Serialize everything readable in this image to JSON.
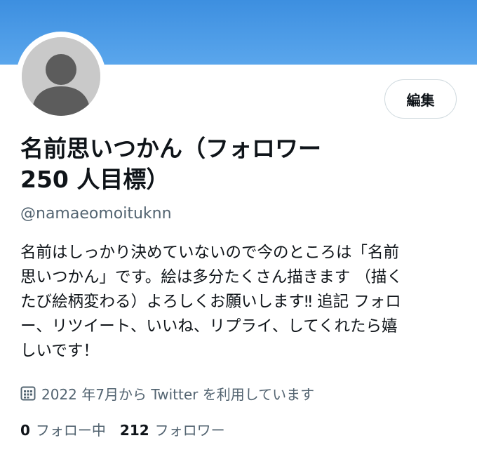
{
  "banner": {
    "color_top": "#3d8fe0",
    "color_bottom": "#5aa6ec"
  },
  "avatar": {
    "icon": "default-profile-silhouette",
    "background": "#c9c9c9"
  },
  "edit_button": {
    "label": "編集"
  },
  "profile": {
    "display_name_line1": "名前思いつかん（フォロワー",
    "display_name_line2": "250 人目標）",
    "handle": "@namaeomoituknn",
    "bio_lines": [
      "名前はしっかり決めていないので今のところは「名前",
      "思いつかん」です。絵は多分たくさん描きます （描く",
      "たび絵柄変わる）よろしくお願いします‼︎ 追記 フォロ",
      "ー、リツイート、いいね、リプライ、してくれたら嬉",
      "しいです！"
    ],
    "joined_icon": "calendar-icon",
    "joined_text": "2022 年7月から Twitter を利用しています"
  },
  "stats": {
    "following_count": "0",
    "following_label": "フォロー中",
    "followers_count": "212",
    "followers_label": "フォロワー"
  }
}
